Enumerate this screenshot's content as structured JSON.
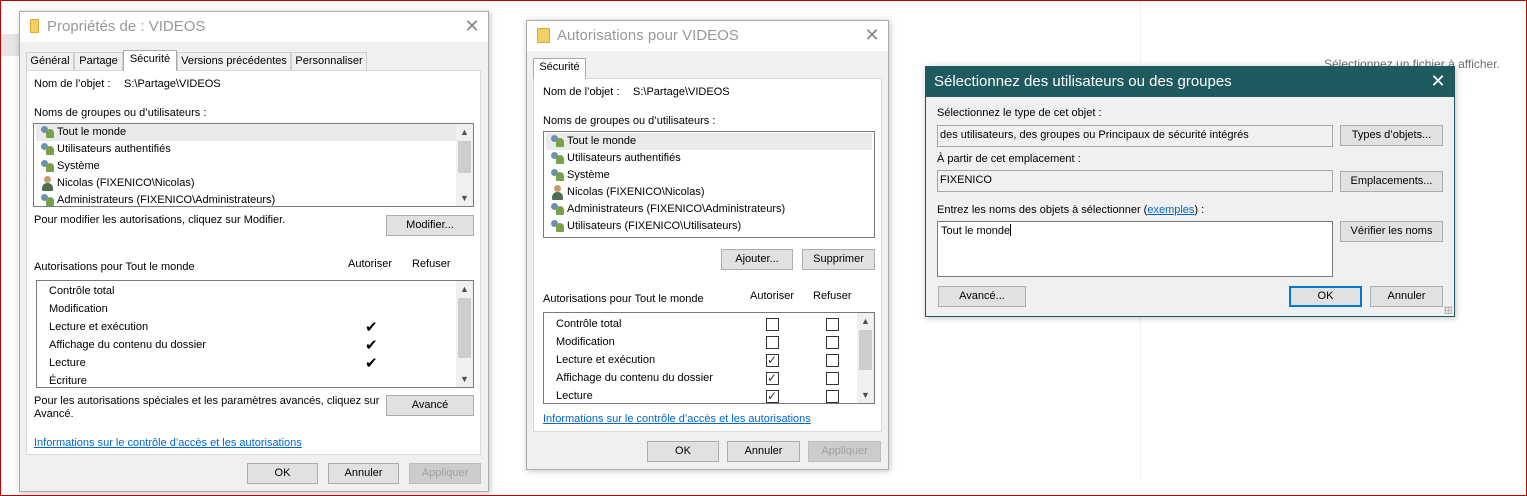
{
  "background": {
    "preview_text": "Sélectionnez un fichier à afficher."
  },
  "props": {
    "title": "Propriétés de : VIDEOS",
    "tabs": [
      "Général",
      "Partage",
      "Sécurité",
      "Versions précédentes",
      "Personnaliser"
    ],
    "object_label": "Nom de l’objet :",
    "object_value": "S:\\Partage\\VIDEOS",
    "groups_label": "Noms de groupes ou d’utilisateurs :",
    "users": [
      "Tout le monde",
      "Utilisateurs authentifiés",
      "Système",
      "Nicolas (FIXENICO\\Nicolas)",
      "Administrateurs (FIXENICO\\Administrateurs)"
    ],
    "modify_hint": "Pour modifier les autorisations, cliquez sur Modifier.",
    "modify_button": "Modifier...",
    "perms_label": "Autorisations pour Tout le monde",
    "allow_col": "Autoriser",
    "deny_col": "Refuser",
    "permissions": [
      {
        "name": "Contrôle total",
        "allow": false,
        "deny": false
      },
      {
        "name": "Modification",
        "allow": false,
        "deny": false
      },
      {
        "name": "Lecture et exécution",
        "allow": true,
        "deny": false
      },
      {
        "name": "Affichage du contenu du dossier",
        "allow": true,
        "deny": false
      },
      {
        "name": "Lecture",
        "allow": true,
        "deny": false
      },
      {
        "name": "Écriture",
        "allow": false,
        "deny": false
      }
    ],
    "advanced_hint_line1": "Pour les autorisations spéciales et les paramètres avancés, cliquez sur",
    "advanced_hint_line2": "Avancé.",
    "advanced_button": "Avancé",
    "info_link": "Informations sur le contrôle d’accès et les autorisations",
    "ok": "OK",
    "cancel": "Annuler",
    "apply": "Appliquer"
  },
  "auth": {
    "title": "Autorisations pour VIDEOS",
    "tab": "Sécurité",
    "object_label": "Nom de l’objet :",
    "object_value": "S:\\Partage\\VIDEOS",
    "groups_label": "Noms de groupes ou d’utilisateurs :",
    "users": [
      "Tout le monde",
      "Utilisateurs authentifiés",
      "Système",
      "Nicolas (FIXENICO\\Nicolas)",
      "Administrateurs (FIXENICO\\Administrateurs)",
      "Utilisateurs (FIXENICO\\Utilisateurs)"
    ],
    "add_button": "Ajouter...",
    "remove_button": "Supprimer",
    "perms_label": "Autorisations pour Tout le monde",
    "allow_col": "Autoriser",
    "deny_col": "Refuser",
    "permissions": [
      {
        "name": "Contrôle total",
        "allow": false,
        "deny": false
      },
      {
        "name": "Modification",
        "allow": false,
        "deny": false
      },
      {
        "name": "Lecture et exécution",
        "allow": true,
        "deny": false
      },
      {
        "name": "Affichage du contenu du dossier",
        "allow": true,
        "deny": false
      },
      {
        "name": "Lecture",
        "allow": true,
        "deny": false
      }
    ],
    "info_link": "Informations sur le contrôle d’accès et les autorisations",
    "ok": "OK",
    "cancel": "Annuler",
    "apply": "Appliquer"
  },
  "select": {
    "title": "Sélectionnez des utilisateurs ou des groupes",
    "type_label": "Sélectionnez le type de cet objet :",
    "type_value": "des utilisateurs, des groupes ou Principaux de sécurité intégrés",
    "type_button": "Types d’objets...",
    "location_label": "À partir de cet emplacement :",
    "location_value": "FIXENICO",
    "location_button": "Emplacements...",
    "names_label_before": "Entrez les noms des objets à sélectionner (",
    "names_link": "exemples",
    "names_label_after": ") :",
    "names_value": "Tout le monde",
    "check_button": "Vérifier les noms",
    "advanced_button": "Avancé...",
    "ok": "OK",
    "cancel": "Annuler"
  }
}
